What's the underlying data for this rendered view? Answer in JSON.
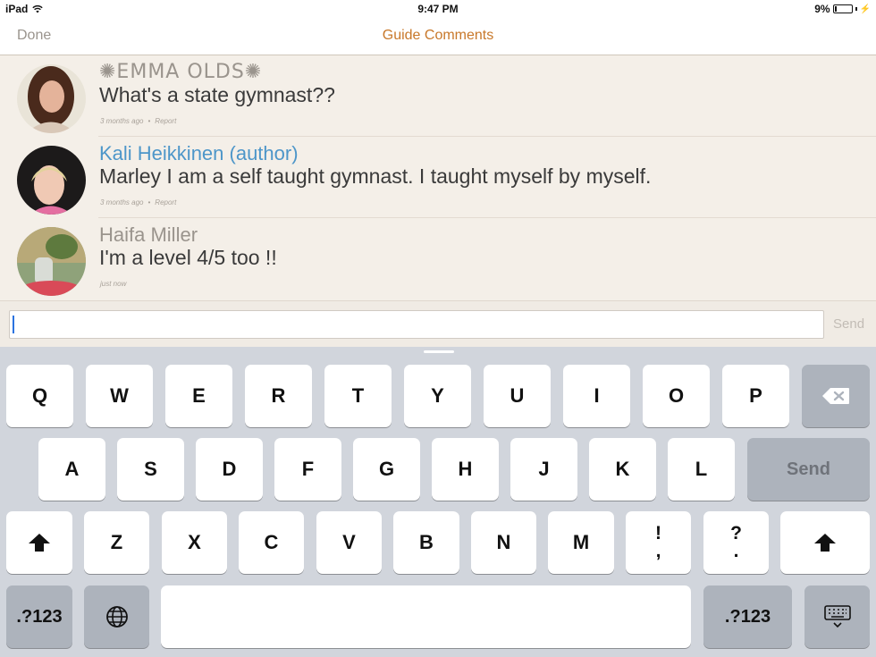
{
  "status_bar": {
    "device": "iPad",
    "time": "9:47 PM",
    "battery": "9%"
  },
  "nav": {
    "done_label": "Done",
    "title": "Guide Comments"
  },
  "comments": [
    {
      "name": "✺EMMA OLDS✺",
      "text": "What's a state gymnast??",
      "time": "3 months ago",
      "action": "Report",
      "avatar_icon": "user-avatar"
    },
    {
      "name": "Kali Heikkinen (author)",
      "text": "Marley I am a self taught gymnast.  I taught myself by myself.",
      "time": "3 months ago",
      "action": "Report",
      "avatar_icon": "user-avatar"
    },
    {
      "name": "Haifa Miller",
      "text": "I'm a level 4/5 too !!",
      "time": "just now",
      "avatar_icon": "user-avatar"
    }
  ],
  "composer": {
    "value": "",
    "send_label": "Send"
  },
  "keyboard": {
    "row1": [
      "Q",
      "W",
      "E",
      "R",
      "T",
      "Y",
      "U",
      "I",
      "O",
      "P"
    ],
    "row2": [
      "A",
      "S",
      "D",
      "F",
      "G",
      "H",
      "J",
      "K",
      "L"
    ],
    "row3": [
      "Z",
      "X",
      "C",
      "V",
      "B",
      "N",
      "M"
    ],
    "punct1": [
      "!",
      ","
    ],
    "punct2": [
      "?",
      "."
    ],
    "send_label": "Send",
    "numbers_label": ".?123",
    "icons": [
      "delete-icon",
      "shift-icon",
      "globe-icon",
      "hide-keyboard-icon"
    ]
  },
  "colors": {
    "accent": "#c8782a",
    "author": "#4d96c9",
    "background": "#f4efe8",
    "keyboard": "#d1d5dc"
  }
}
